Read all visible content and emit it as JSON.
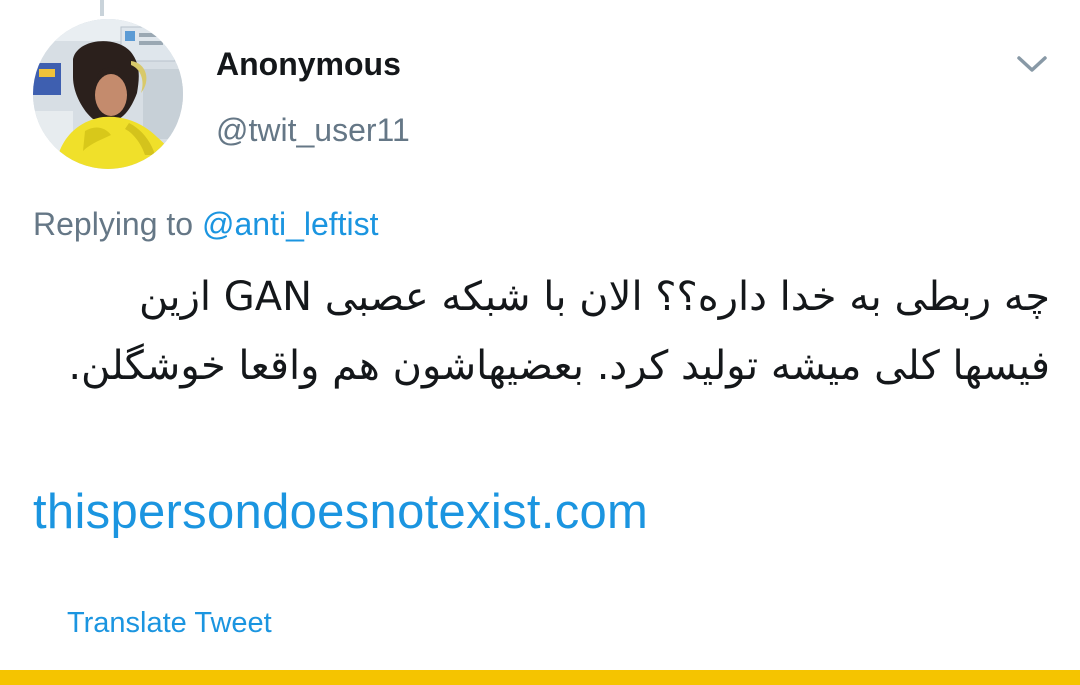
{
  "tweet": {
    "author": {
      "name": "Anonymous",
      "handle": "@twit_user11",
      "avatar_icon": "user-photo-avatar"
    },
    "menu_icon": "chevron-down-icon",
    "reply": {
      "prefix": "Replying to",
      "mention": "@anti_leftist"
    },
    "text": "چه ربطی به خدا داره؟؟  الان با شبکه عصبی GAN ازین فیسها کلی میشه تولید کرد. بعضیهاشون هم واقعا خوشگلن.",
    "link": "thispersondoesnotexist.com",
    "translate_label": "Translate Tweet"
  },
  "colors": {
    "text_primary": "#14171a",
    "text_secondary": "#657786",
    "link": "#1b95e0",
    "bottom_bar": "#f5c400"
  }
}
